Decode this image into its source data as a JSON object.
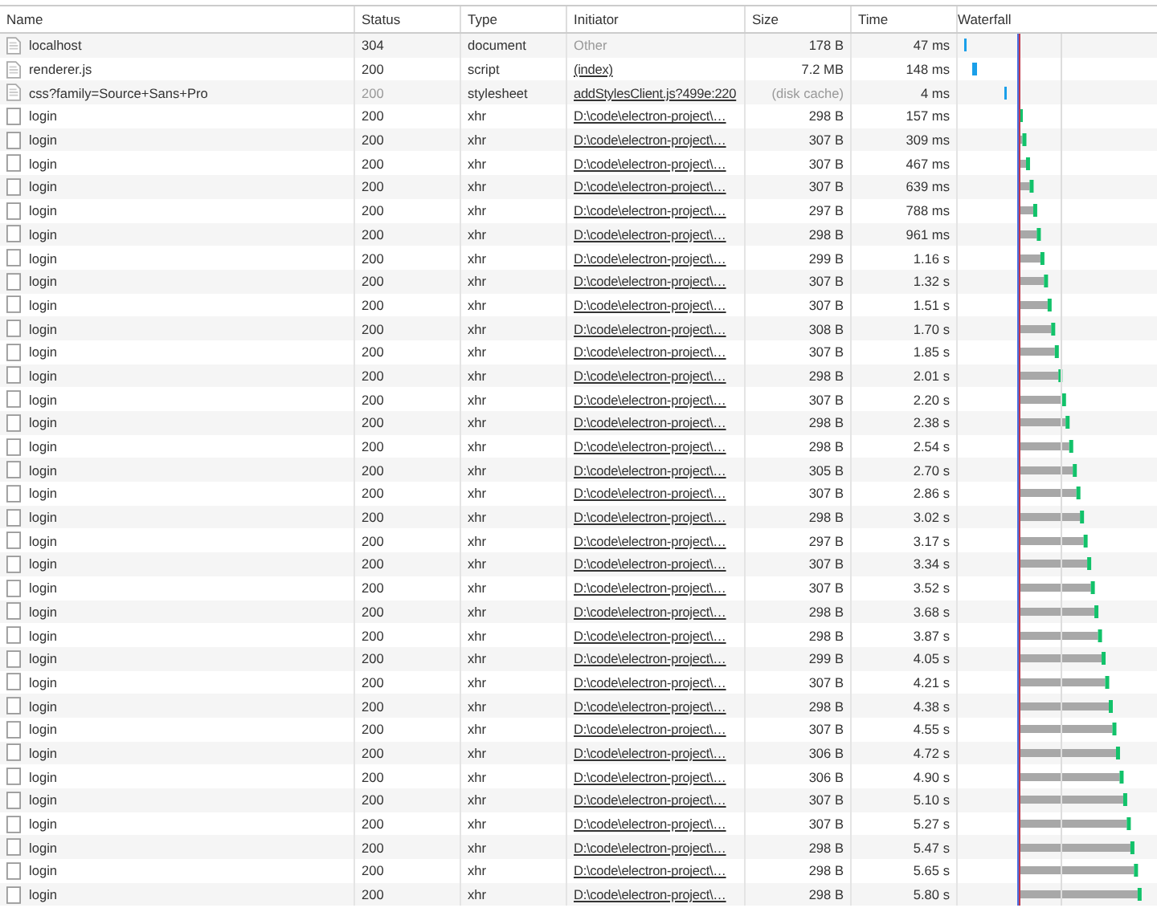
{
  "table": {
    "columns": [
      "Name",
      "Status",
      "Type",
      "Initiator",
      "Size",
      "Time",
      "Waterfall"
    ],
    "rows": [
      {
        "kind": "file",
        "name": "localhost",
        "status": "304",
        "type": "document",
        "initiator": "Other",
        "initiator_link": false,
        "size": "178 B",
        "from_cache": false,
        "time": "47 ms"
      },
      {
        "kind": "file",
        "name": "renderer.js",
        "status": "200",
        "type": "script",
        "initiator": "(index)",
        "initiator_link": true,
        "size": "7.2 MB",
        "from_cache": false,
        "time": "148 ms"
      },
      {
        "kind": "file",
        "name": "css?family=Source+Sans+Pro",
        "status": "200",
        "type": "stylesheet",
        "initiator": "addStylesClient.js?499e:220",
        "initiator_link": true,
        "size": "(disk cache)",
        "from_cache": true,
        "time": "4 ms"
      },
      {
        "kind": "xhr",
        "name": "login",
        "status": "200",
        "type": "xhr",
        "initiator": "D:\\code\\electron-project\\…",
        "initiator_link": true,
        "size": "298 B",
        "from_cache": false,
        "time": "157 ms"
      },
      {
        "kind": "xhr",
        "name": "login",
        "status": "200",
        "type": "xhr",
        "initiator": "D:\\code\\electron-project\\…",
        "initiator_link": true,
        "size": "307 B",
        "from_cache": false,
        "time": "309 ms"
      },
      {
        "kind": "xhr",
        "name": "login",
        "status": "200",
        "type": "xhr",
        "initiator": "D:\\code\\electron-project\\…",
        "initiator_link": true,
        "size": "307 B",
        "from_cache": false,
        "time": "467 ms"
      },
      {
        "kind": "xhr",
        "name": "login",
        "status": "200",
        "type": "xhr",
        "initiator": "D:\\code\\electron-project\\…",
        "initiator_link": true,
        "size": "307 B",
        "from_cache": false,
        "time": "639 ms"
      },
      {
        "kind": "xhr",
        "name": "login",
        "status": "200",
        "type": "xhr",
        "initiator": "D:\\code\\electron-project\\…",
        "initiator_link": true,
        "size": "297 B",
        "from_cache": false,
        "time": "788 ms"
      },
      {
        "kind": "xhr",
        "name": "login",
        "status": "200",
        "type": "xhr",
        "initiator": "D:\\code\\electron-project\\…",
        "initiator_link": true,
        "size": "298 B",
        "from_cache": false,
        "time": "961 ms"
      },
      {
        "kind": "xhr",
        "name": "login",
        "status": "200",
        "type": "xhr",
        "initiator": "D:\\code\\electron-project\\…",
        "initiator_link": true,
        "size": "299 B",
        "from_cache": false,
        "time": "1.16 s"
      },
      {
        "kind": "xhr",
        "name": "login",
        "status": "200",
        "type": "xhr",
        "initiator": "D:\\code\\electron-project\\…",
        "initiator_link": true,
        "size": "307 B",
        "from_cache": false,
        "time": "1.32 s"
      },
      {
        "kind": "xhr",
        "name": "login",
        "status": "200",
        "type": "xhr",
        "initiator": "D:\\code\\electron-project\\…",
        "initiator_link": true,
        "size": "307 B",
        "from_cache": false,
        "time": "1.51 s"
      },
      {
        "kind": "xhr",
        "name": "login",
        "status": "200",
        "type": "xhr",
        "initiator": "D:\\code\\electron-project\\…",
        "initiator_link": true,
        "size": "308 B",
        "from_cache": false,
        "time": "1.70 s"
      },
      {
        "kind": "xhr",
        "name": "login",
        "status": "200",
        "type": "xhr",
        "initiator": "D:\\code\\electron-project\\…",
        "initiator_link": true,
        "size": "307 B",
        "from_cache": false,
        "time": "1.85 s"
      },
      {
        "kind": "xhr",
        "name": "login",
        "status": "200",
        "type": "xhr",
        "initiator": "D:\\code\\electron-project\\…",
        "initiator_link": true,
        "size": "298 B",
        "from_cache": false,
        "time": "2.01 s"
      },
      {
        "kind": "xhr",
        "name": "login",
        "status": "200",
        "type": "xhr",
        "initiator": "D:\\code\\electron-project\\…",
        "initiator_link": true,
        "size": "307 B",
        "from_cache": false,
        "time": "2.20 s"
      },
      {
        "kind": "xhr",
        "name": "login",
        "status": "200",
        "type": "xhr",
        "initiator": "D:\\code\\electron-project\\…",
        "initiator_link": true,
        "size": "298 B",
        "from_cache": false,
        "time": "2.38 s"
      },
      {
        "kind": "xhr",
        "name": "login",
        "status": "200",
        "type": "xhr",
        "initiator": "D:\\code\\electron-project\\…",
        "initiator_link": true,
        "size": "298 B",
        "from_cache": false,
        "time": "2.54 s"
      },
      {
        "kind": "xhr",
        "name": "login",
        "status": "200",
        "type": "xhr",
        "initiator": "D:\\code\\electron-project\\…",
        "initiator_link": true,
        "size": "305 B",
        "from_cache": false,
        "time": "2.70 s"
      },
      {
        "kind": "xhr",
        "name": "login",
        "status": "200",
        "type": "xhr",
        "initiator": "D:\\code\\electron-project\\…",
        "initiator_link": true,
        "size": "307 B",
        "from_cache": false,
        "time": "2.86 s"
      },
      {
        "kind": "xhr",
        "name": "login",
        "status": "200",
        "type": "xhr",
        "initiator": "D:\\code\\electron-project\\…",
        "initiator_link": true,
        "size": "298 B",
        "from_cache": false,
        "time": "3.02 s"
      },
      {
        "kind": "xhr",
        "name": "login",
        "status": "200",
        "type": "xhr",
        "initiator": "D:\\code\\electron-project\\…",
        "initiator_link": true,
        "size": "297 B",
        "from_cache": false,
        "time": "3.17 s"
      },
      {
        "kind": "xhr",
        "name": "login",
        "status": "200",
        "type": "xhr",
        "initiator": "D:\\code\\electron-project\\…",
        "initiator_link": true,
        "size": "307 B",
        "from_cache": false,
        "time": "3.34 s"
      },
      {
        "kind": "xhr",
        "name": "login",
        "status": "200",
        "type": "xhr",
        "initiator": "D:\\code\\electron-project\\…",
        "initiator_link": true,
        "size": "307 B",
        "from_cache": false,
        "time": "3.52 s"
      },
      {
        "kind": "xhr",
        "name": "login",
        "status": "200",
        "type": "xhr",
        "initiator": "D:\\code\\electron-project\\…",
        "initiator_link": true,
        "size": "298 B",
        "from_cache": false,
        "time": "3.68 s"
      },
      {
        "kind": "xhr",
        "name": "login",
        "status": "200",
        "type": "xhr",
        "initiator": "D:\\code\\electron-project\\…",
        "initiator_link": true,
        "size": "298 B",
        "from_cache": false,
        "time": "3.87 s"
      },
      {
        "kind": "xhr",
        "name": "login",
        "status": "200",
        "type": "xhr",
        "initiator": "D:\\code\\electron-project\\…",
        "initiator_link": true,
        "size": "299 B",
        "from_cache": false,
        "time": "4.05 s"
      },
      {
        "kind": "xhr",
        "name": "login",
        "status": "200",
        "type": "xhr",
        "initiator": "D:\\code\\electron-project\\…",
        "initiator_link": true,
        "size": "307 B",
        "from_cache": false,
        "time": "4.21 s"
      },
      {
        "kind": "xhr",
        "name": "login",
        "status": "200",
        "type": "xhr",
        "initiator": "D:\\code\\electron-project\\…",
        "initiator_link": true,
        "size": "298 B",
        "from_cache": false,
        "time": "4.38 s"
      },
      {
        "kind": "xhr",
        "name": "login",
        "status": "200",
        "type": "xhr",
        "initiator": "D:\\code\\electron-project\\…",
        "initiator_link": true,
        "size": "307 B",
        "from_cache": false,
        "time": "4.55 s"
      },
      {
        "kind": "xhr",
        "name": "login",
        "status": "200",
        "type": "xhr",
        "initiator": "D:\\code\\electron-project\\…",
        "initiator_link": true,
        "size": "306 B",
        "from_cache": false,
        "time": "4.72 s"
      },
      {
        "kind": "xhr",
        "name": "login",
        "status": "200",
        "type": "xhr",
        "initiator": "D:\\code\\electron-project\\…",
        "initiator_link": true,
        "size": "306 B",
        "from_cache": false,
        "time": "4.90 s"
      },
      {
        "kind": "xhr",
        "name": "login",
        "status": "200",
        "type": "xhr",
        "initiator": "D:\\code\\electron-project\\…",
        "initiator_link": true,
        "size": "307 B",
        "from_cache": false,
        "time": "5.10 s"
      },
      {
        "kind": "xhr",
        "name": "login",
        "status": "200",
        "type": "xhr",
        "initiator": "D:\\code\\electron-project\\…",
        "initiator_link": true,
        "size": "307 B",
        "from_cache": false,
        "time": "5.27 s"
      },
      {
        "kind": "xhr",
        "name": "login",
        "status": "200",
        "type": "xhr",
        "initiator": "D:\\code\\electron-project\\…",
        "initiator_link": true,
        "size": "298 B",
        "from_cache": false,
        "time": "5.47 s"
      },
      {
        "kind": "xhr",
        "name": "login",
        "status": "200",
        "type": "xhr",
        "initiator": "D:\\code\\electron-project\\…",
        "initiator_link": true,
        "size": "298 B",
        "from_cache": false,
        "time": "5.65 s"
      },
      {
        "kind": "xhr",
        "name": "login",
        "status": "200",
        "type": "xhr",
        "initiator": "D:\\code\\electron-project\\…",
        "initiator_link": true,
        "size": "298 B",
        "from_cache": false,
        "time": "5.80 s"
      }
    ]
  }
}
